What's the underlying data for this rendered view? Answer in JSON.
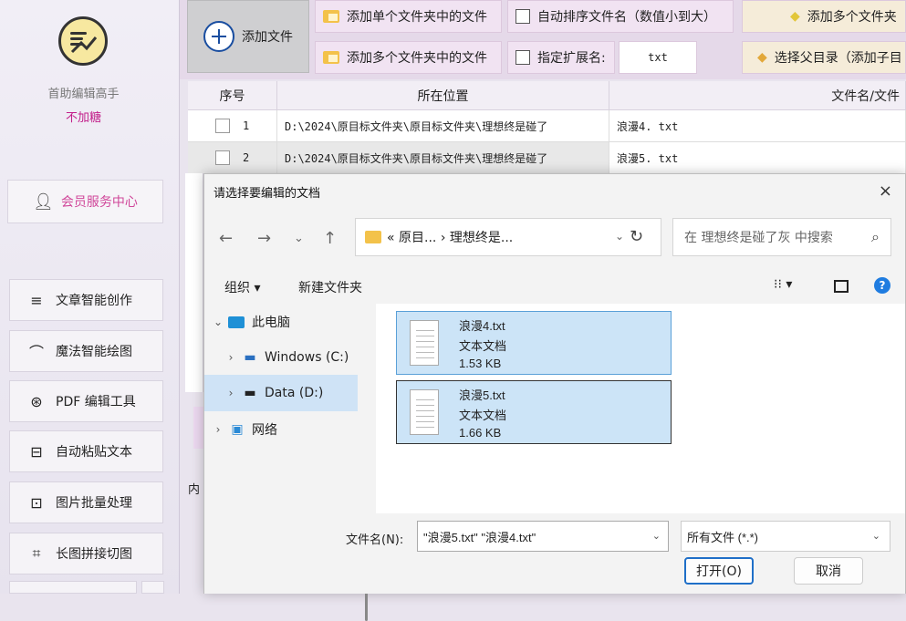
{
  "sidebar": {
    "app_name": "首助编辑高手",
    "app_sub": "不加糖",
    "member_label": "会员服务中心",
    "items": [
      {
        "label": "文章智能创作",
        "icon": "menu-lines-icon"
      },
      {
        "label": "魔法智能绘图",
        "icon": "brush-icon"
      },
      {
        "label": "PDF 编辑工具",
        "icon": "pdf-circle-icon"
      },
      {
        "label": "自动粘贴文本",
        "icon": "paste-box-icon"
      },
      {
        "label": "图片批量处理",
        "icon": "image-frame-icon"
      },
      {
        "label": "长图拼接切图",
        "icon": "crop-icon"
      }
    ]
  },
  "toolbar": {
    "add_file": "添加文件",
    "add_single_folder": "添加单个文件夹中的文件",
    "add_multi_folder": "添加多个文件夹中的文件",
    "auto_sort": "自动排序文件名（数值小到大）",
    "ext_label": "指定扩展名:",
    "ext_value": "txt",
    "add_multi_right": "添加多个文件夹",
    "select_parent": "选择父目录（添加子目"
  },
  "table": {
    "headers": [
      "序号",
      "所在位置",
      "文件名/文件"
    ],
    "rows": [
      {
        "index": "1",
        "path": "D:\\2024\\原目标文件夹\\原目标文件夹\\理想终是碰了",
        "name": "浪漫4. txt"
      },
      {
        "index": "2",
        "path": "D:\\2024\\原目标文件夹\\原目标文件夹\\理想终是碰了",
        "name": "浪漫5. txt"
      }
    ],
    "behind_text": "内"
  },
  "dialog": {
    "title": "请选择要编辑的文档",
    "close": "×",
    "address": "« 原目... › 理想终是...",
    "search_placeholder": "在 理想终是碰了灰 中搜索",
    "organize": "组织 ▾",
    "new_folder": "新建文件夹",
    "tree": [
      {
        "label": "此电脑",
        "arrow": "⌄"
      },
      {
        "label": "Windows (C:)",
        "arrow": "›"
      },
      {
        "label": "Data (D:)",
        "arrow": "›"
      },
      {
        "label": "网络",
        "arrow": "›"
      }
    ],
    "files": [
      {
        "name": "浪漫4.txt",
        "type": "文本文档",
        "size": "1.53 KB"
      },
      {
        "name": "浪漫5.txt",
        "type": "文本文档",
        "size": "1.66 KB"
      }
    ],
    "filename_label": "文件名(N):",
    "filename_value": "\"浪漫5.txt\" \"浪漫4.txt\"",
    "filetype_value": "所有文件 (*.*)",
    "open_button": "打开(O)",
    "cancel_button": "取消",
    "help": "?"
  }
}
